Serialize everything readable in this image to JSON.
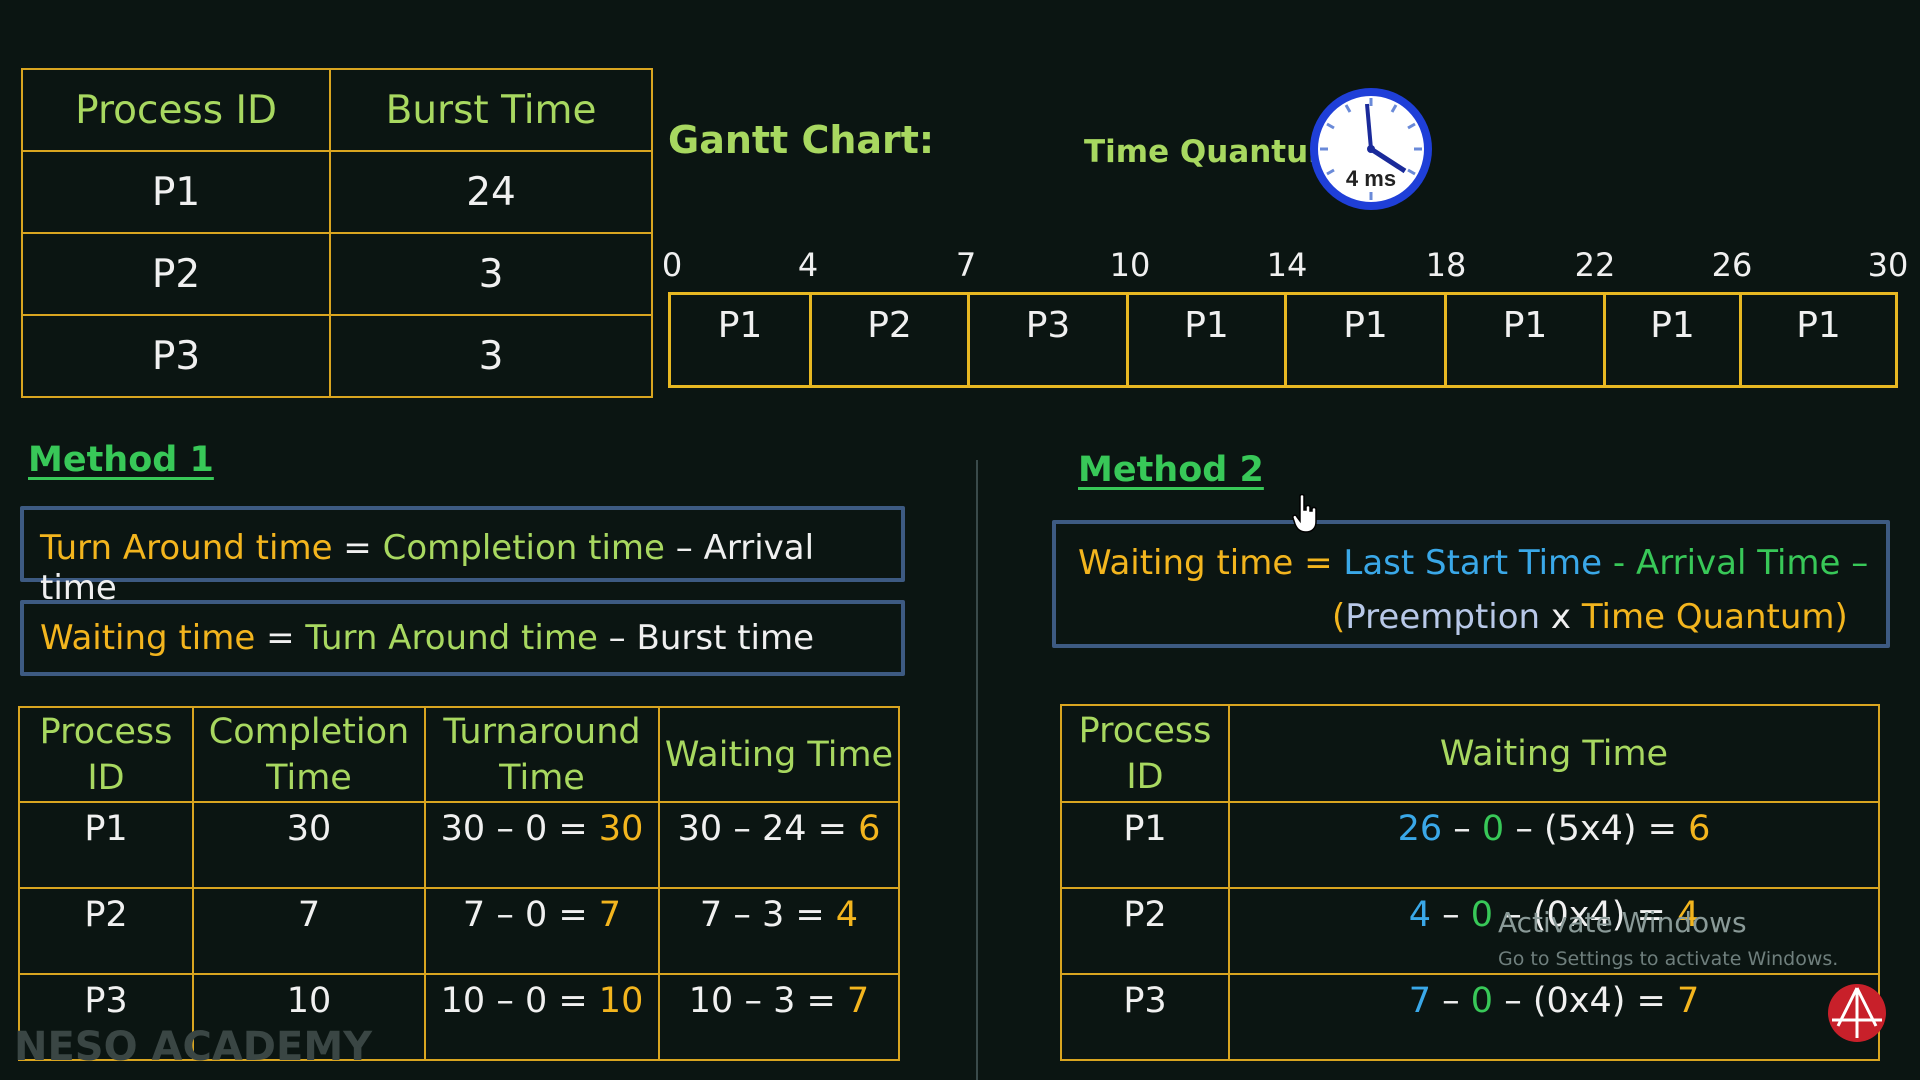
{
  "process_table": {
    "headers": [
      "Process ID",
      "Burst Time"
    ],
    "rows": [
      [
        "P1",
        "24"
      ],
      [
        "P2",
        "3"
      ],
      [
        "P3",
        "3"
      ]
    ]
  },
  "gantt": {
    "title": "Gantt Chart:",
    "time_quantum_label": "Time Quantum",
    "clock_label": "4 ms",
    "ticks": [
      "0",
      "4",
      "7",
      "10",
      "14",
      "18",
      "22",
      "26",
      "30"
    ],
    "blocks": [
      "P1",
      "P2",
      "P3",
      "P1",
      "P1",
      "P1",
      "P1",
      "P1"
    ]
  },
  "method1": {
    "title": "Method 1",
    "formula1": {
      "a": "Turn Around time",
      "eq": " = ",
      "b": "Completion time",
      "op": " – ",
      "c": "Arrival time"
    },
    "formula2": {
      "a": "Waiting time",
      "eq": " = ",
      "b": "Turn Around time",
      "op": " – ",
      "c": "Burst time"
    },
    "table": {
      "headers": [
        "Process ID",
        "Completion Time",
        "Turnaround Time",
        "Waiting Time"
      ],
      "rows": [
        {
          "pid": "P1",
          "ct": "30",
          "tat_expr": "30 – 0 = ",
          "tat": "30",
          "wt_expr": "30 – 24 = ",
          "wt": "6"
        },
        {
          "pid": "P2",
          "ct": "7",
          "tat_expr": "7 – 0 = ",
          "tat": "7",
          "wt_expr": "7 – 3 = ",
          "wt": "4"
        },
        {
          "pid": "P3",
          "ct": "10",
          "tat_expr": "10 – 0 = ",
          "tat": "10",
          "wt_expr": "10 – 3 = ",
          "wt": "7"
        }
      ]
    }
  },
  "method2": {
    "title": "Method 2",
    "formula": {
      "a": "Waiting time",
      "eq": " = ",
      "b": "Last Start Time",
      "op1": " - ",
      "c": "Arrival Time",
      "op2": " –",
      "p_open": "(",
      "d": "Preemption",
      "x": " x ",
      "e": "Time Quantum",
      "p_close": ")"
    },
    "table": {
      "headers": [
        "Process ID",
        "Waiting Time"
      ],
      "rows": [
        {
          "pid": "P1",
          "lst": "26",
          "at": "0",
          "rest": "– (5x4) = ",
          "wt": "6"
        },
        {
          "pid": "P2",
          "lst": "4",
          "at": "0",
          "rest": "– (0x4) = ",
          "wt": "4"
        },
        {
          "pid": "P3",
          "lst": "7",
          "at": "0",
          "rest": "– (0x4) = ",
          "wt": "7"
        }
      ]
    }
  },
  "watermark": {
    "line1": "Activate Windows",
    "line2": "Go to Settings to activate Windows."
  },
  "brand": "NESO ACADEMY",
  "colors": {
    "yellow": "#f3b51e",
    "green": "#a8d860",
    "bright_green": "#38c858",
    "blue": "#3aa8e8",
    "border": "#d9a520"
  }
}
